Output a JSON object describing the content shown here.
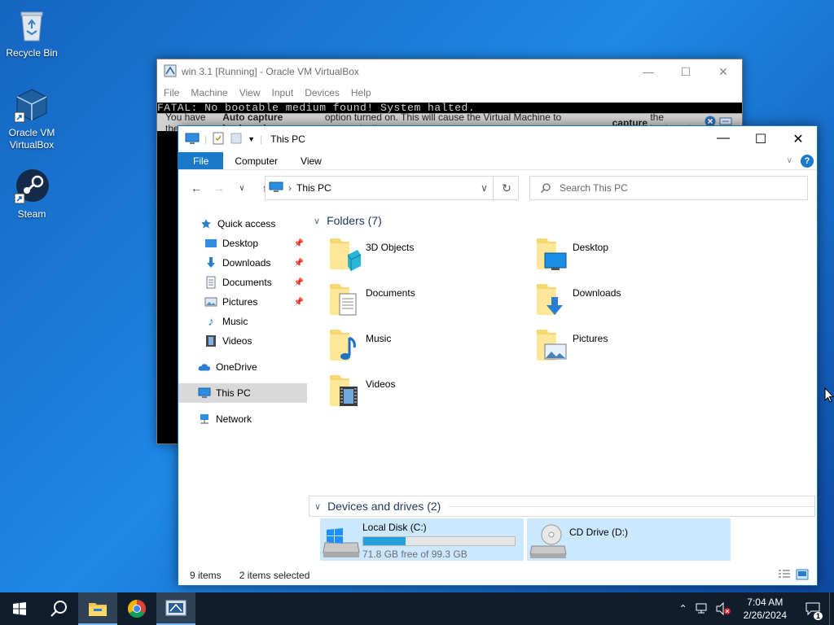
{
  "desktop": {
    "icons": [
      {
        "label": "Recycle Bin"
      },
      {
        "label": "Oracle VM VirtualBox"
      },
      {
        "label": "Steam"
      }
    ]
  },
  "vbox": {
    "title": "win 3.1 [Running] - Oracle VM VirtualBox",
    "menu": [
      "File",
      "Machine",
      "View",
      "Input",
      "Devices",
      "Help"
    ],
    "fatal_text": "FATAL: No bootable medium found! System halted.",
    "banner": {
      "prefix": "You have the ",
      "bold1": "Auto capture keyboard",
      "middle": " option turned on. This will cause the Virtual Machine to automatically ",
      "bold2": "capture",
      "suffix": " the keyboard"
    }
  },
  "explorer": {
    "title": "This PC",
    "ribbon_tabs": {
      "file": "File",
      "computer": "Computer",
      "view": "View"
    },
    "address": "This PC",
    "search_placeholder": "Search This PC",
    "nav": {
      "quick_access": "Quick access",
      "desktop": "Desktop",
      "downloads": "Downloads",
      "documents": "Documents",
      "pictures": "Pictures",
      "music": "Music",
      "videos": "Videos",
      "onedrive": "OneDrive",
      "this_pc": "This PC",
      "network": "Network"
    },
    "folders_header": "Folders (7)",
    "folders": {
      "objects3d": "3D Objects",
      "desktop": "Desktop",
      "documents": "Documents",
      "downloads": "Downloads",
      "music": "Music",
      "pictures": "Pictures",
      "videos": "Videos"
    },
    "drives_header": "Devices and drives (2)",
    "drives": {
      "c": {
        "name": "Local Disk (C:)",
        "free": "71.8 GB free of 99.3 GB",
        "used_fraction": 0.277
      },
      "d": {
        "name": "CD Drive (D:)"
      }
    },
    "status": {
      "items": "9 items",
      "selected": "2 items selected"
    }
  },
  "taskbar": {
    "time": "7:04 AM",
    "date": "2/26/2024",
    "notification_count": "1"
  }
}
